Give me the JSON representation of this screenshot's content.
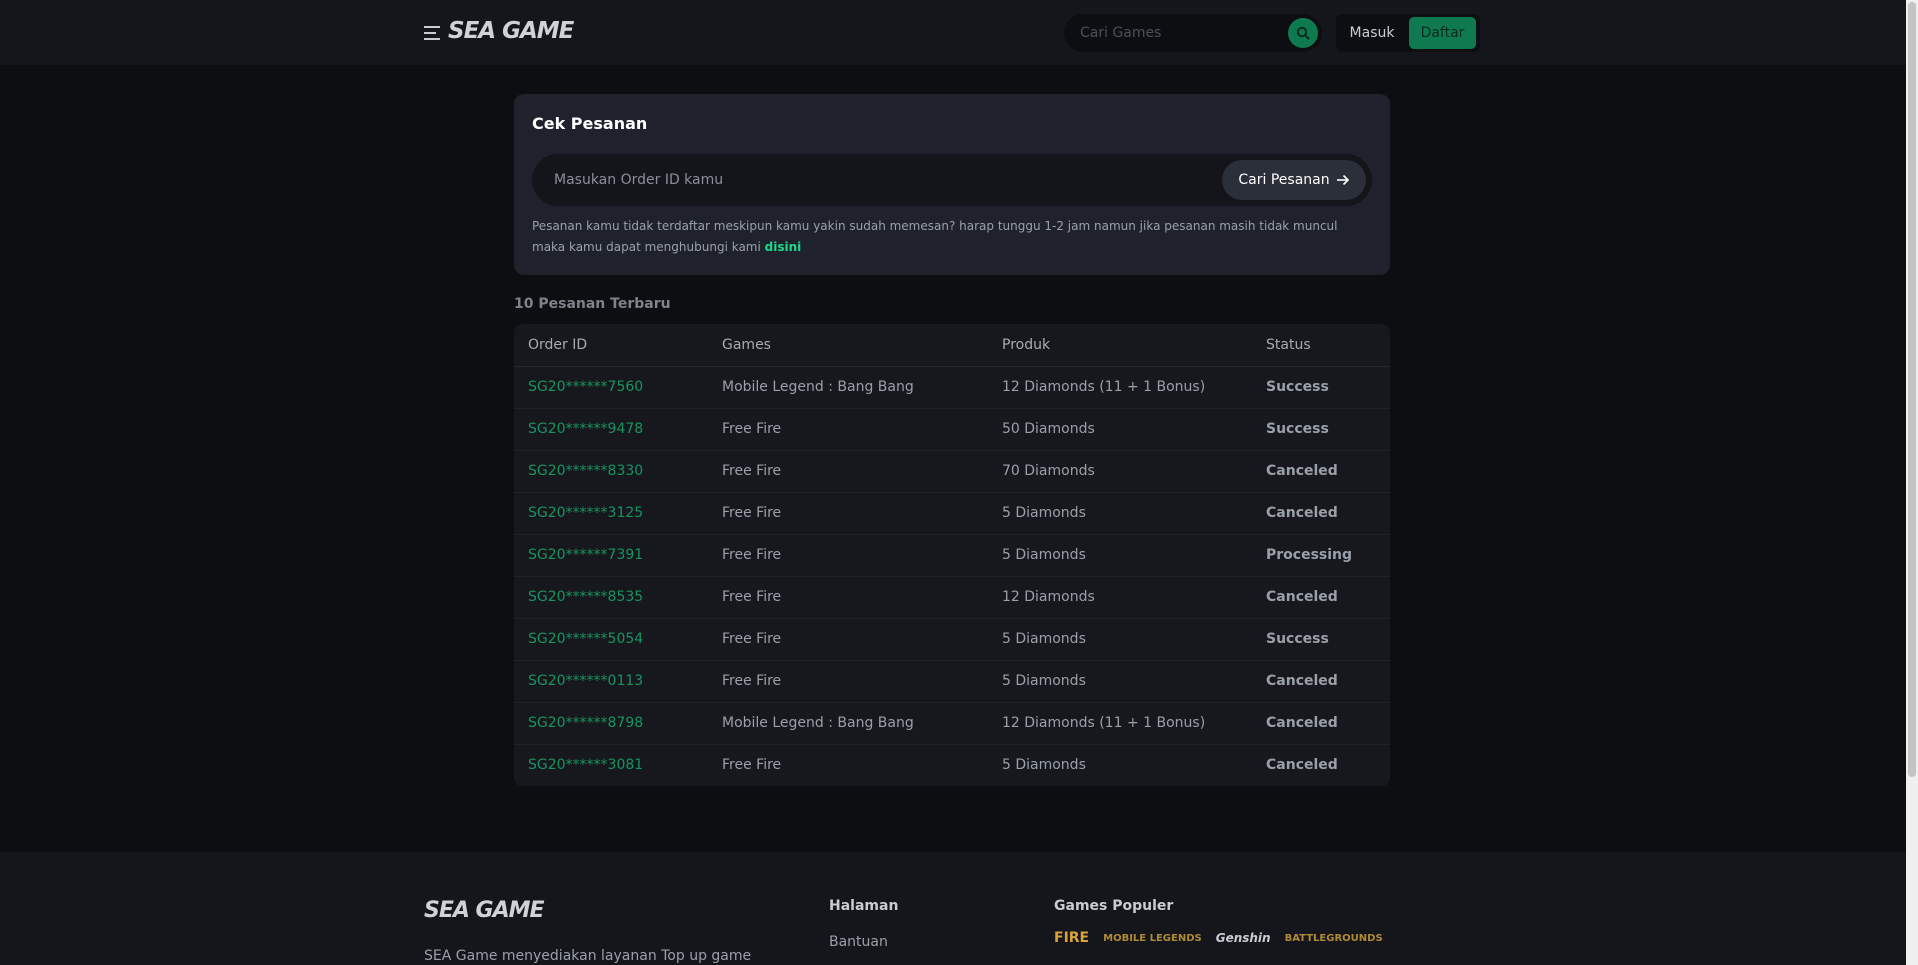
{
  "header": {
    "logo": "SEA GAME",
    "search_placeholder": "Cari Games",
    "login_label": "Masuk",
    "register_label": "Daftar"
  },
  "cek_pesanan": {
    "title": "Cek Pesanan",
    "input_placeholder": "Masukan Order ID kamu",
    "button_label": "Cari Pesanan",
    "note": "Pesanan kamu tidak terdaftar meskipun kamu yakin sudah memesan? harap tunggu 1-2 jam namun jika pesanan masih tidak muncul maka kamu dapat menghubungi kami",
    "note_link": "disini"
  },
  "recent": {
    "title": "10 Pesanan Terbaru",
    "columns": [
      "Order ID",
      "Games",
      "Produk",
      "Status"
    ],
    "rows": [
      {
        "id": "SG20******7560",
        "game": "Mobile Legend : Bang Bang",
        "product": "12 Diamonds (11 + 1 Bonus)",
        "status": "Success"
      },
      {
        "id": "SG20******9478",
        "game": "Free Fire",
        "product": "50 Diamonds",
        "status": "Success"
      },
      {
        "id": "SG20******8330",
        "game": "Free Fire",
        "product": "70 Diamonds",
        "status": "Canceled"
      },
      {
        "id": "SG20******3125",
        "game": "Free Fire",
        "product": "5 Diamonds",
        "status": "Canceled"
      },
      {
        "id": "SG20******7391",
        "game": "Free Fire",
        "product": "5 Diamonds",
        "status": "Processing"
      },
      {
        "id": "SG20******8535",
        "game": "Free Fire",
        "product": "12 Diamonds",
        "status": "Canceled"
      },
      {
        "id": "SG20******5054",
        "game": "Free Fire",
        "product": "5 Diamonds",
        "status": "Success"
      },
      {
        "id": "SG20******0113",
        "game": "Free Fire",
        "product": "5 Diamonds",
        "status": "Canceled"
      },
      {
        "id": "SG20******8798",
        "game": "Mobile Legend : Bang Bang",
        "product": "12 Diamonds (11 + 1 Bonus)",
        "status": "Canceled"
      },
      {
        "id": "SG20******3081",
        "game": "Free Fire",
        "product": "5 Diamonds",
        "status": "Canceled"
      }
    ]
  },
  "footer": {
    "logo": "SEA GAME",
    "description": "SEA Game menyediakan layanan Top up game",
    "pages_heading": "Halaman",
    "pages_link": "Bantuan",
    "popular_heading": "Games Populer",
    "game_logos": [
      "FIRE",
      "MOBILE LEGENDS",
      "Genshin",
      "BATTLEGROUNDS"
    ]
  },
  "colors": {
    "accent": "#0f7a50",
    "link": "#1fd98b",
    "success": "#2f9a45",
    "canceled": "#c0282e",
    "processing": "#1d8ab3"
  }
}
